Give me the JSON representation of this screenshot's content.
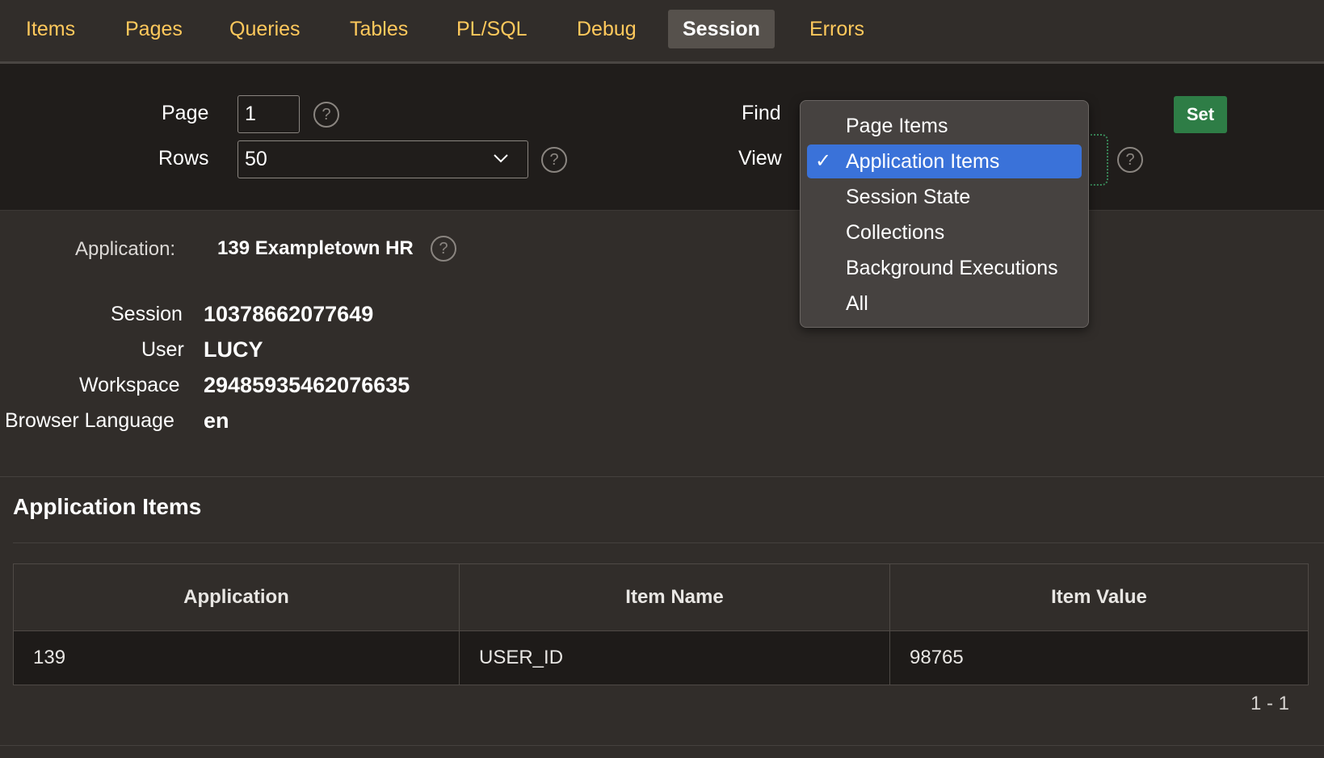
{
  "tabs": [
    {
      "label": "Items"
    },
    {
      "label": "Pages"
    },
    {
      "label": "Queries"
    },
    {
      "label": "Tables"
    },
    {
      "label": "PL/SQL"
    },
    {
      "label": "Debug"
    },
    {
      "label": "Session",
      "active": true
    },
    {
      "label": "Errors"
    }
  ],
  "controls": {
    "page_label": "Page",
    "page_value": "1",
    "rows_label": "Rows",
    "rows_value": "50",
    "find_label": "Find",
    "view_label": "View",
    "set_label": "Set",
    "help_glyph": "?"
  },
  "view_menu": {
    "items": [
      {
        "label": "Page Items",
        "selected": false
      },
      {
        "label": "Application Items",
        "selected": true
      },
      {
        "label": "Session State",
        "selected": false
      },
      {
        "label": "Collections",
        "selected": false
      },
      {
        "label": "Background Executions",
        "selected": false
      },
      {
        "label": "All",
        "selected": false
      }
    ],
    "check_glyph": "✓"
  },
  "info": {
    "application_label": "Application:",
    "application_value": "139 Exampletown HR",
    "session_label": "Session",
    "session_value": "10378662077649",
    "user_label": "User",
    "user_value": "LUCY",
    "workspace_label": "Workspace",
    "workspace_value": "29485935462076635",
    "browser_language_label": "Browser Language",
    "browser_language_value": "en"
  },
  "section": {
    "title": "Application Items"
  },
  "table": {
    "columns": [
      "Application",
      "Item Name",
      "Item Value"
    ],
    "rows": [
      [
        "139",
        "USER_ID",
        "98765"
      ]
    ]
  },
  "pager": "1 - 1",
  "colors": {
    "tab_text": "#ffc95c",
    "set_button": "#2e7d46",
    "menu_selected": "#3a72d9"
  }
}
